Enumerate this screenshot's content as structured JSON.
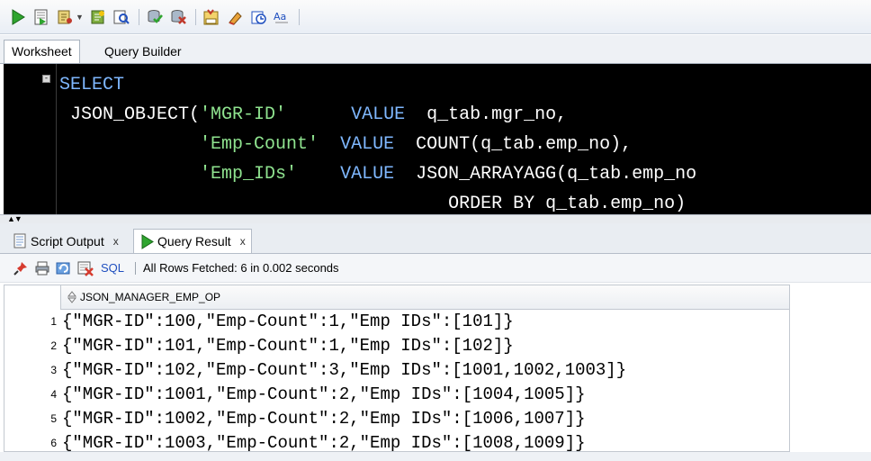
{
  "editor_tabs": {
    "worksheet": "Worksheet",
    "query_builder": "Query Builder"
  },
  "sql": {
    "line1": {
      "kw": "SELECT"
    },
    "line2": {
      "fn": " JSON_OBJECT(",
      "str": "'MGR-ID'",
      "gap": "      ",
      "kw": "VALUE",
      "rest": "  q_tab.mgr_no,"
    },
    "line3": {
      "pad": "             ",
      "str": "'Emp-Count'",
      "gap": "  ",
      "kw": "VALUE",
      "rest": "  COUNT(q_tab.emp_no),"
    },
    "line4": {
      "pad": "             ",
      "str": "'Emp_IDs'",
      "gap": "    ",
      "kw": "VALUE",
      "rest": "  JSON_ARRAYAGG(q_tab.emp_no"
    },
    "line5": {
      "pad": "                                    ",
      "rest": "ORDER BY q_tab.emp_no)"
    }
  },
  "result_tabs": {
    "script_output": "Script Output",
    "query_result": "Query Result",
    "close": "x"
  },
  "result_toolbar": {
    "sql": "SQL",
    "status": "All Rows Fetched: 6 in 0.002 seconds"
  },
  "grid": {
    "column": "JSON_MANAGER_EMP_OP",
    "rows": [
      {
        "n": "1",
        "v": "{\"MGR-ID\":100,\"Emp-Count\":1,\"Emp IDs\":[101]}"
      },
      {
        "n": "2",
        "v": "{\"MGR-ID\":101,\"Emp-Count\":1,\"Emp IDs\":[102]}"
      },
      {
        "n": "3",
        "v": "{\"MGR-ID\":102,\"Emp-Count\":3,\"Emp IDs\":[1001,1002,1003]}"
      },
      {
        "n": "4",
        "v": "{\"MGR-ID\":1001,\"Emp-Count\":2,\"Emp IDs\":[1004,1005]}"
      },
      {
        "n": "5",
        "v": "{\"MGR-ID\":1002,\"Emp-Count\":2,\"Emp IDs\":[1006,1007]}"
      },
      {
        "n": "6",
        "v": "{\"MGR-ID\":1003,\"Emp-Count\":2,\"Emp IDs\":[1008,1009]}"
      }
    ]
  },
  "icons": [
    "run-statement-icon",
    "run-script-icon",
    "explain-plan-icon",
    "autotrace-icon",
    "sql-tuning-icon",
    "commit-icon",
    "rollback-icon",
    "format-sql-icon",
    "clear-icon",
    "history-icon",
    "case-toggle-icon"
  ],
  "colors": {
    "editor_bg": "#000000",
    "keyword": "#7fb8ff",
    "string": "#8fe38f",
    "link": "#1f4fbf"
  }
}
